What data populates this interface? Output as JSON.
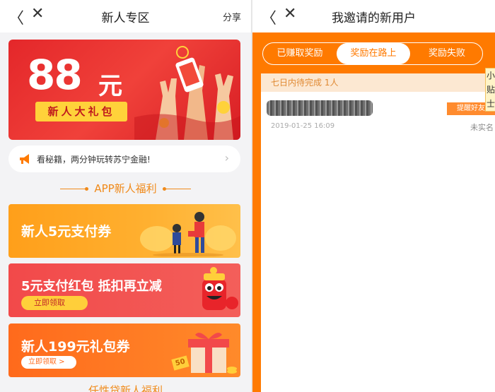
{
  "left": {
    "nav": {
      "title": "新人专区",
      "share": "分享",
      "back": "〈",
      "close": "✕"
    },
    "hero": {
      "amount": "88",
      "unit": "元",
      "ribbon": "新人大礼包"
    },
    "notice": {
      "text": "看秘籍，两分钟玩转苏宁金融!",
      "chevron": "›"
    },
    "section_title": "APP新人福利",
    "cards": [
      {
        "label": "新人5元支付券"
      },
      {
        "label": "5元支付红包  抵扣再立减",
        "button": "立即领取"
      },
      {
        "label": "新人199元礼包券",
        "button": "立即领取 >",
        "badge": "50"
      }
    ],
    "section_title_2": "任性贷新人福利"
  },
  "right": {
    "nav": {
      "title": "我邀请的新用户",
      "back": "〈",
      "close": "✕"
    },
    "tabs": [
      {
        "label": "已赚取奖励"
      },
      {
        "label": "奖励在路上"
      },
      {
        "label": "奖励失败"
      }
    ],
    "group_header": "七日内待完成 1人",
    "entries": [
      {
        "date": "2019-01-25 16:09",
        "remind": "提醒好友",
        "status": "未实名"
      }
    ],
    "side_tag": "小贴士"
  },
  "colors": {
    "accent_orange": "#ff7a00",
    "hero_red": "#e4272a",
    "section_orange": "#f08a1a"
  }
}
